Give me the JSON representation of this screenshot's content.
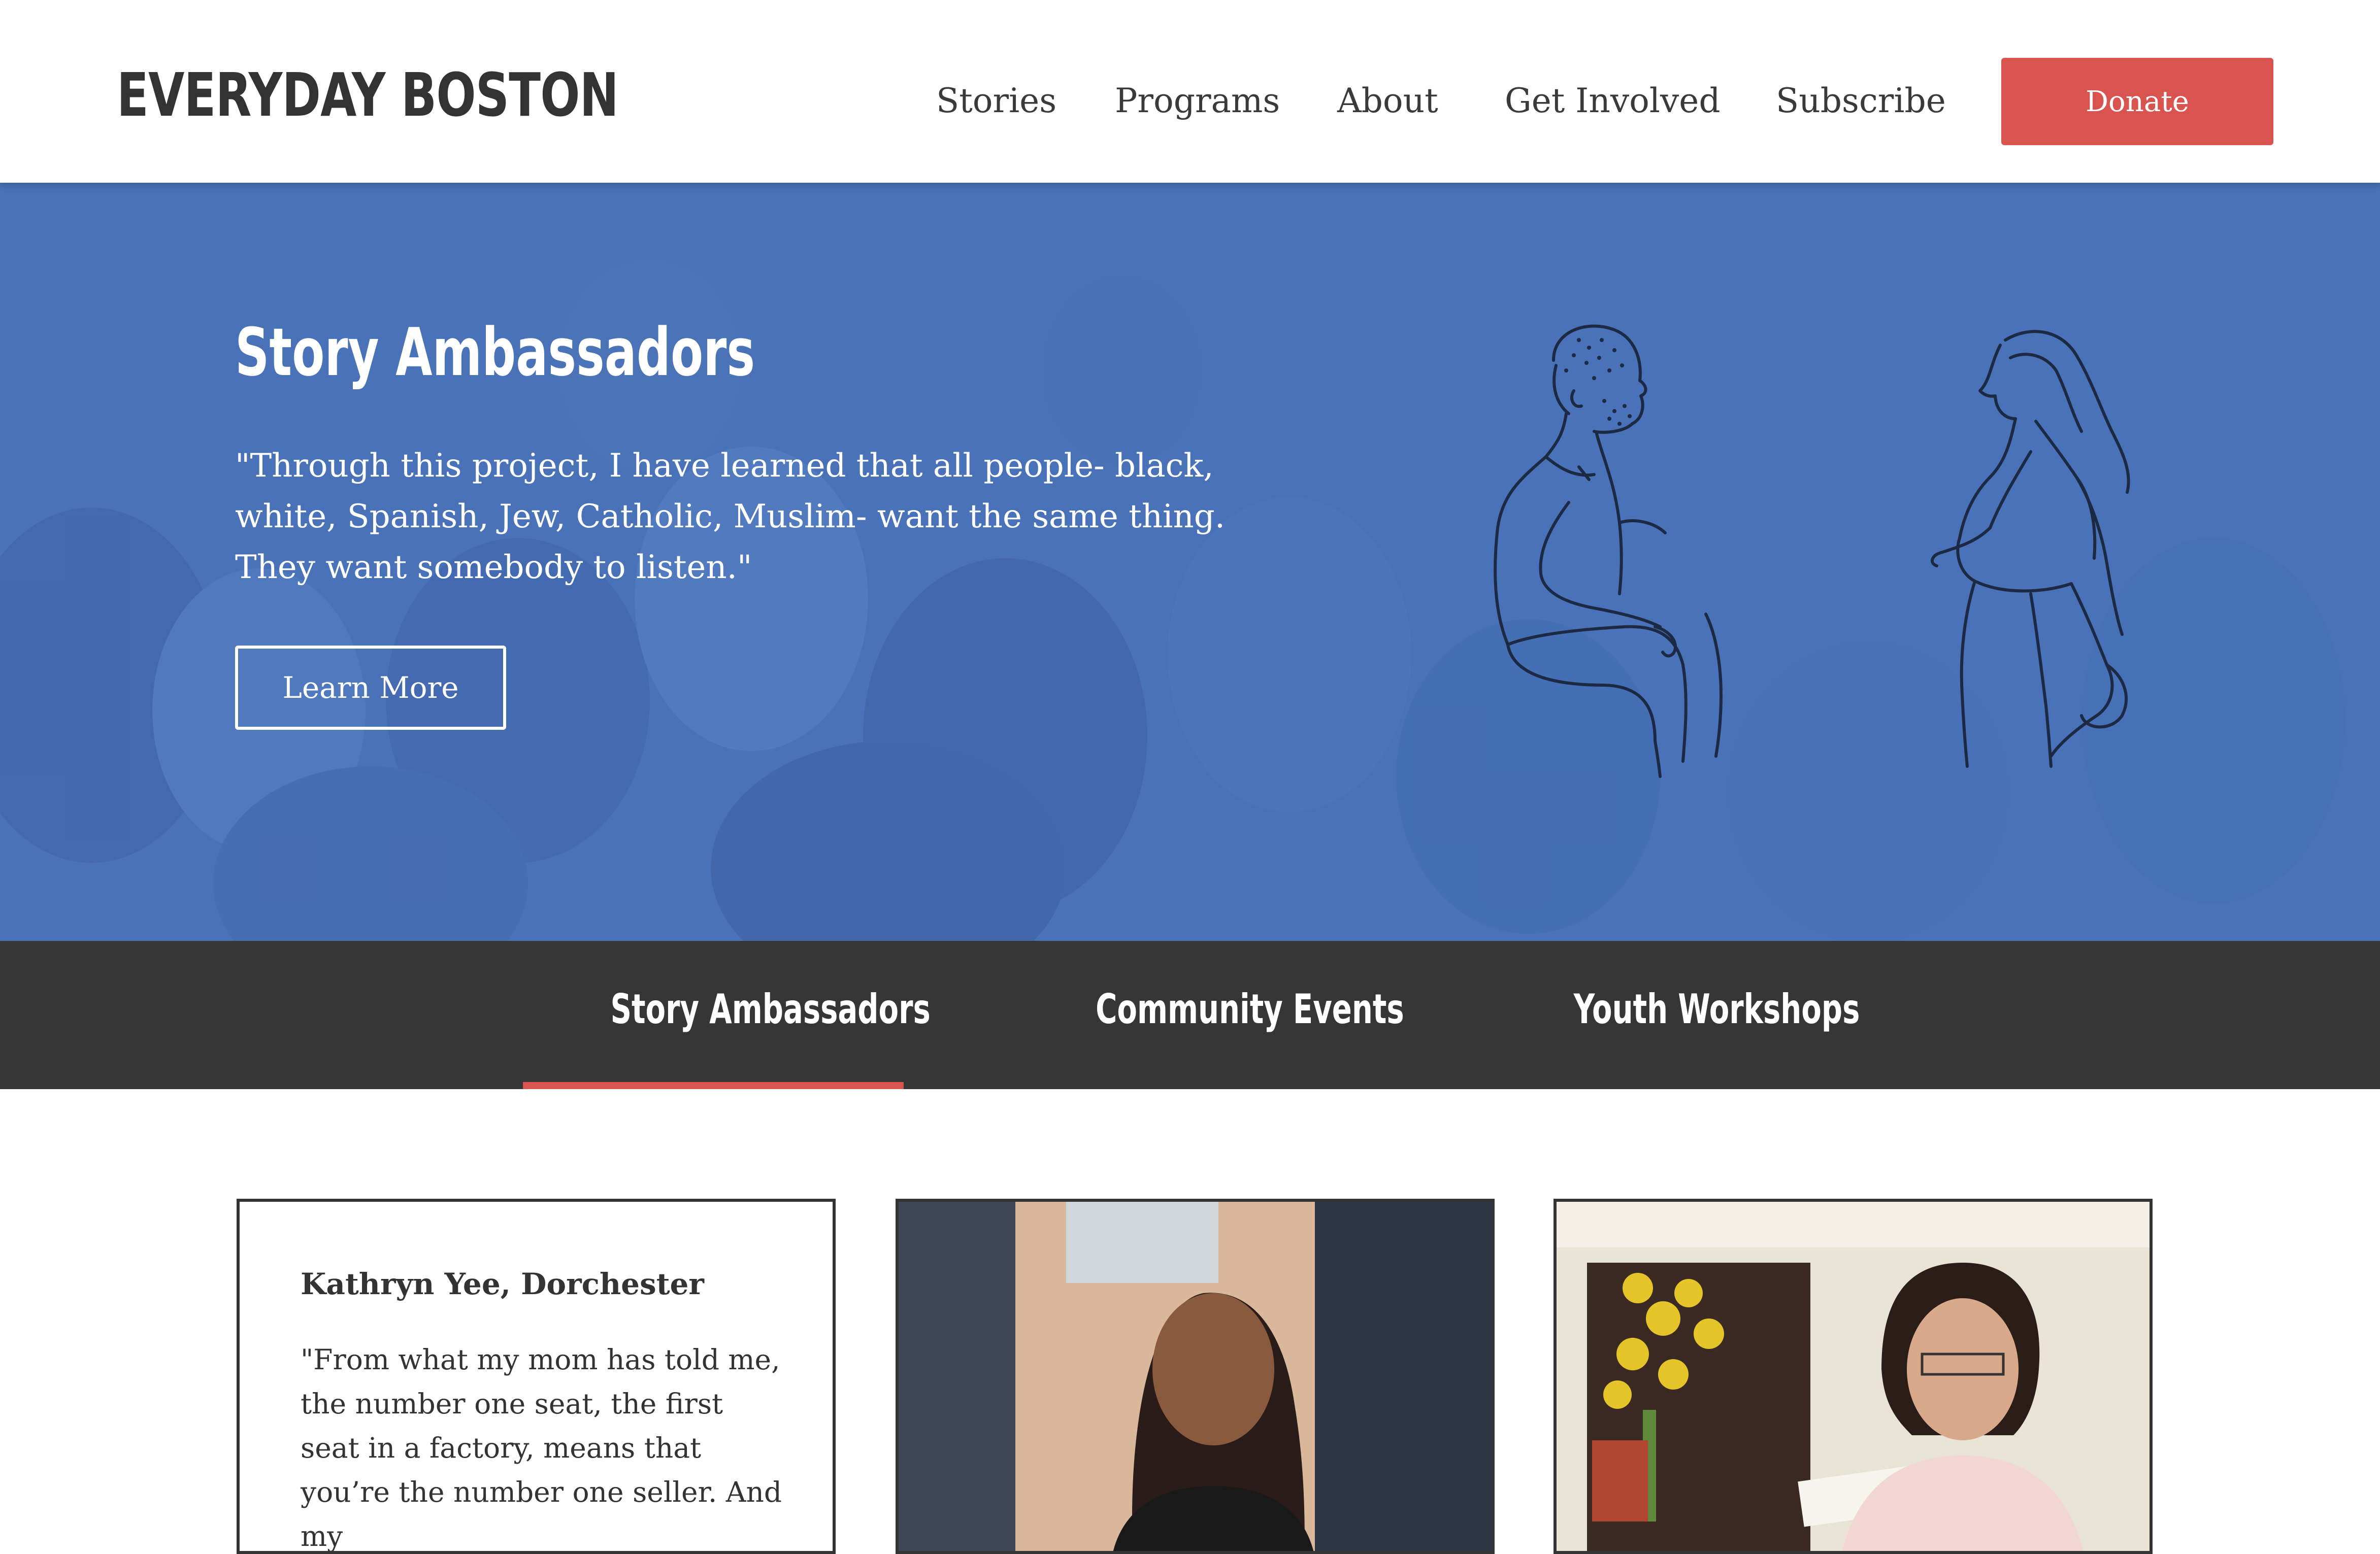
{
  "header": {
    "logo": "EVERYDAY BOSTON",
    "nav": [
      "Stories",
      "Programs",
      "About",
      "Get Involved",
      "Subscribe"
    ],
    "donate_label": "Donate"
  },
  "hero": {
    "title": "Story Ambassadors",
    "quote": "\"Through this project, I have learned that all people- black, white, Spanish, Jew, Catholic, Muslim- want the same thing. They want somebody to listen.\"",
    "button_label": "Learn More",
    "background_color": "#4a72b8",
    "accent_color": "#d9534f"
  },
  "tabs": {
    "items": [
      "Story Ambassadors",
      "Community Events",
      "Youth Workshops"
    ],
    "active_index": 0
  },
  "cards": [
    {
      "name": "Kathryn Yee, Dorchester",
      "quote": "\"From what my mom has told me, the number one seat, the first seat in a factory, means that you’re the number one seller. And my"
    }
  ]
}
